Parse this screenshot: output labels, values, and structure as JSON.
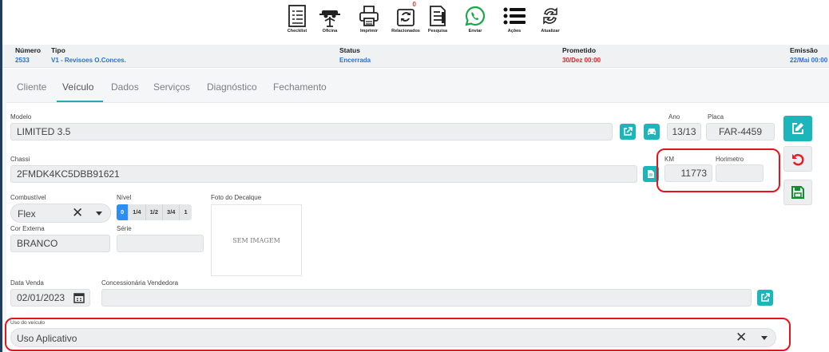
{
  "toolbar": {
    "items": [
      {
        "label": "Checklist",
        "icon": "checklist-icon"
      },
      {
        "label": "Oficina",
        "icon": "lift-icon"
      },
      {
        "label": "Imprimir",
        "icon": "printer-icon"
      },
      {
        "label": "Relacionados",
        "icon": "related-icon",
        "badge": "0"
      },
      {
        "label": "Pesquisa",
        "icon": "document-icon"
      },
      {
        "label": "Enviar",
        "icon": "whatsapp-icon"
      },
      {
        "label": "Ações",
        "icon": "menu-list-icon"
      },
      {
        "label": "Atualizar",
        "icon": "refresh-icon"
      }
    ]
  },
  "header": {
    "numero_label": "Número",
    "numero": "2533",
    "tipo_label": "Tipo",
    "tipo": "V1 - Revisoes O.Conces.",
    "status_label": "Status",
    "status": "Encerrada",
    "prometido_label": "Prometido",
    "prometido": "30/Dez 00:00",
    "emissao_label": "Emissão",
    "emissao": "22/Mai 00:00"
  },
  "tabs": [
    "Cliente",
    "Veículo",
    "Dados",
    "Serviços",
    "Diagnóstico",
    "Fechamento"
  ],
  "active_tab": "Veículo",
  "form": {
    "modelo_label": "Modelo",
    "modelo": "LIMITED 3.5",
    "ano_label": "Ano",
    "ano": "13/13",
    "placa_label": "Placa",
    "placa": "FAR-4459",
    "chassi_label": "Chassi",
    "chassi": "2FMDK4KC5DBB91621",
    "km_label": "KM",
    "km": "11773",
    "horimetro_label": "Horimetro",
    "horimetro": "",
    "combustivel_label": "Combustível",
    "combustivel": "Flex",
    "nivel_label": "Nível",
    "nivel_options": [
      "0",
      "1/4",
      "1/2",
      "3/4",
      "1"
    ],
    "nivel_selected": "0",
    "foto_label": "Foto do Decalque",
    "sem_imagem": "SEM IMAGEM",
    "cor_label": "Cor Externa",
    "cor": "BRANCO",
    "serie_label": "Série",
    "serie": "",
    "data_venda_label": "Data Venda",
    "data_venda": "02/01/2023",
    "concessionaria_label": "Concessionária Vendedora",
    "concessionaria": "",
    "uso_label": "Uso do veículo",
    "uso": "Uso Aplicativo"
  },
  "colors": {
    "accent": "#1cb5b9",
    "link": "#2b6fd6",
    "danger": "#e0202a",
    "save": "#0f8f2f",
    "highlight": "#e4141d"
  }
}
